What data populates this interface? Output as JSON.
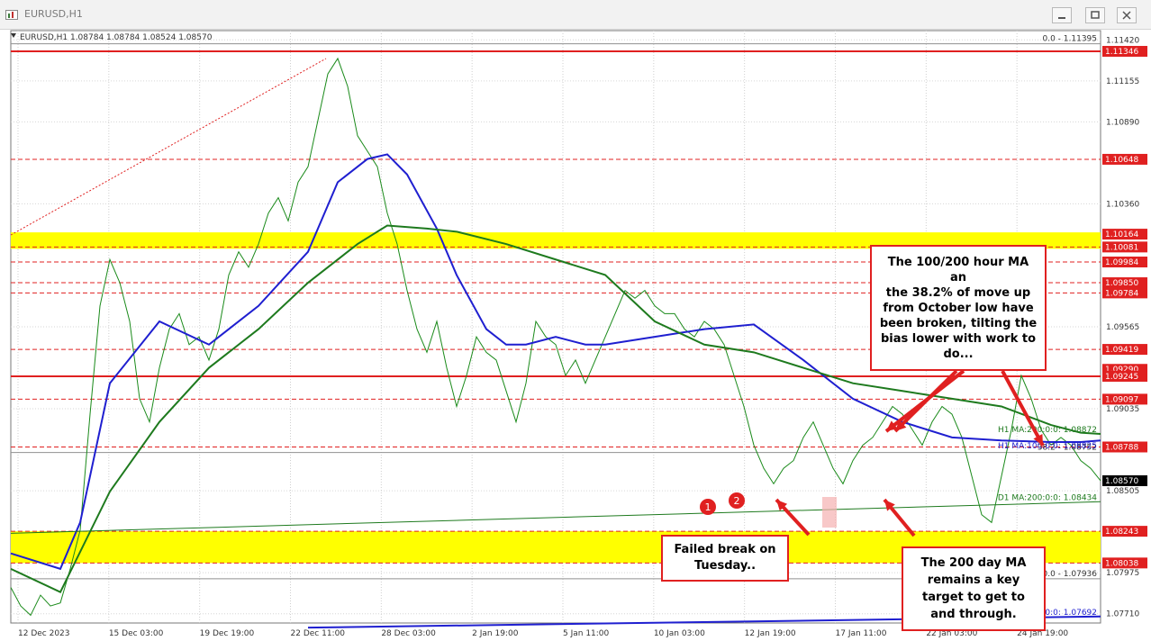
{
  "window": {
    "title": "EURUSD,H1",
    "icon": "chart-window-icon",
    "buttons": [
      "minimize-icon",
      "maximize-icon",
      "close-icon"
    ]
  },
  "header": {
    "text": "EURUSD,H1  1.08784 1.08784 1.08524 1.08570"
  },
  "colors": {
    "price": "#1a8a1a",
    "ma100": "#1f1fd0",
    "ma200": "#1e7a1e",
    "redline": "#e02020",
    "yellow": "#ffff00",
    "annot": "#e02020"
  },
  "chart_data": {
    "type": "line",
    "title": "",
    "xlabel": "",
    "ylabel": "",
    "ylim": [
      1.0765,
      1.1148
    ],
    "grid": true,
    "x_ticks": [
      "12 Dec 2023",
      "15 Dec 03:00",
      "19 Dec 19:00",
      "22 Dec 11:00",
      "28 Dec 03:00",
      "2 Jan 19:00",
      "5 Jan 11:00",
      "10 Jan 03:00",
      "12 Jan 19:00",
      "17 Jan 11:00",
      "22 Jan 03:00",
      "24 Jan 19:00"
    ],
    "y_ticks": [
      1.1142,
      1.11155,
      1.1089,
      1.1036,
      1.09565,
      1.09035,
      1.08505,
      1.07975,
      1.0771
    ],
    "price_labels": [
      {
        "label": "1.11346",
        "value": 1.11346,
        "style": "red"
      },
      {
        "label": "1.10648",
        "value": 1.10648,
        "style": "red"
      },
      {
        "label": "1.10164",
        "value": 1.10164,
        "style": "red"
      },
      {
        "label": "1.10081",
        "value": 1.10081,
        "style": "red"
      },
      {
        "label": "1.09984",
        "value": 1.09984,
        "style": "red"
      },
      {
        "label": "1.09850",
        "value": 1.0985,
        "style": "red"
      },
      {
        "label": "1.09784",
        "value": 1.09784,
        "style": "red"
      },
      {
        "label": "1.09419",
        "value": 1.09419,
        "style": "red"
      },
      {
        "label": "1.09290",
        "value": 1.0929,
        "style": "red"
      },
      {
        "label": "1.09245",
        "value": 1.09245,
        "style": "red"
      },
      {
        "label": "1.09097",
        "value": 1.09097,
        "style": "red"
      },
      {
        "label": "1.08788",
        "value": 1.08788,
        "style": "red"
      },
      {
        "label": "1.08570",
        "value": 1.0857,
        "style": "black"
      },
      {
        "label": "1.08243",
        "value": 1.08243,
        "style": "red"
      },
      {
        "label": "1.08038",
        "value": 1.08038,
        "style": "red"
      }
    ],
    "levels": [
      {
        "value": 1.11346,
        "style": "solid-red"
      },
      {
        "value": 1.10648,
        "style": "dash-red"
      },
      {
        "value": 1.10081,
        "style": "dash-red"
      },
      {
        "value": 1.09984,
        "style": "dash-red"
      },
      {
        "value": 1.0985,
        "style": "dash-red"
      },
      {
        "value": 1.09784,
        "style": "dash-red"
      },
      {
        "value": 1.09419,
        "style": "dash-red"
      },
      {
        "value": 1.09245,
        "style": "solid-red"
      },
      {
        "value": 1.09097,
        "style": "dash-red"
      },
      {
        "value": 1.08788,
        "style": "dash-red"
      },
      {
        "value": 1.08243,
        "style": "dash-red"
      },
      {
        "value": 1.08038,
        "style": "dash-red"
      },
      {
        "value": 1.07936,
        "style": "solid-grey"
      },
      {
        "value": 1.11395,
        "style": "solid-grey"
      },
      {
        "value": 1.08752,
        "style": "solid-grey"
      }
    ],
    "zones": [
      {
        "from": 1.10081,
        "to": 1.10164
      },
      {
        "from": 1.08038,
        "to": 1.08243
      }
    ],
    "fib_labels": [
      {
        "text": "0.0 - 1.11395",
        "value": 1.11395
      },
      {
        "text": "38.2 - 1.08752",
        "value": 1.08752
      },
      {
        "text": "50.0 - 1.07936",
        "value": 1.07936
      }
    ],
    "ma_labels": [
      {
        "text": "H1 MA:200:0:0: 1.08872",
        "value": 1.08872,
        "color": "green"
      },
      {
        "text": "H1 MA:100:0:0: 1.08825",
        "value": 1.08825,
        "color": "blue"
      },
      {
        "text": "D1 MA:200:0:0: 1.08434",
        "value": 1.08434,
        "color": "green"
      },
      {
        "text": ":100:0:0: 1.07692",
        "value": 1.07692,
        "color": "blue"
      }
    ],
    "series": [
      {
        "role": "price",
        "x": [
          0,
          2,
          4,
          6,
          8,
          10,
          12,
          14,
          16,
          18,
          20,
          22,
          24,
          26,
          28,
          30,
          32,
          34,
          36,
          38,
          40,
          42,
          44,
          46,
          48,
          50,
          52,
          54,
          56,
          58,
          60,
          62,
          64,
          66,
          68,
          70,
          72,
          74,
          76,
          78,
          80,
          82,
          84,
          86,
          88,
          90,
          92,
          94,
          96,
          98,
          100,
          102,
          104,
          106,
          108,
          110,
          112,
          114,
          116,
          118,
          120,
          122,
          124,
          126,
          128,
          130,
          132,
          134,
          136,
          138,
          140,
          142,
          144,
          146,
          148,
          150,
          152,
          154,
          156,
          158,
          160,
          162,
          164,
          166,
          168,
          170,
          172,
          174,
          176,
          178,
          180,
          182,
          184,
          186,
          188,
          190,
          192,
          194,
          196,
          198,
          200,
          202,
          204,
          206,
          208,
          210,
          212,
          214,
          216,
          218,
          220
        ],
        "y": [
          1.0788,
          1.0776,
          1.077,
          1.0783,
          1.0776,
          1.0778,
          1.08,
          1.0825,
          1.09,
          1.097,
          1.1,
          1.0985,
          1.096,
          1.091,
          1.0895,
          1.093,
          1.0955,
          1.0965,
          1.0945,
          1.095,
          1.0935,
          1.0955,
          1.099,
          1.1005,
          1.0995,
          1.101,
          1.103,
          1.104,
          1.1025,
          1.105,
          1.106,
          1.109,
          1.112,
          1.113,
          1.1112,
          1.108,
          1.107,
          1.106,
          1.103,
          1.101,
          1.098,
          1.0955,
          1.094,
          1.096,
          1.093,
          1.0905,
          1.0925,
          1.095,
          1.094,
          1.0935,
          1.0915,
          1.0895,
          1.092,
          1.096,
          1.095,
          1.0945,
          1.0925,
          1.0935,
          1.092,
          1.0935,
          1.095,
          1.0965,
          1.098,
          1.0975,
          1.098,
          1.097,
          1.0965,
          1.0965,
          1.0955,
          1.095,
          1.096,
          1.0955,
          1.0945,
          1.0925,
          1.0905,
          1.088,
          1.0865,
          1.0855,
          1.0865,
          1.087,
          1.0885,
          1.0895,
          1.088,
          1.0865,
          1.0855,
          1.087,
          1.088,
          1.0885,
          1.0895,
          1.0905,
          1.09,
          1.089,
          1.088,
          1.0895,
          1.0905,
          1.09,
          1.0885,
          1.086,
          1.0835,
          1.083,
          1.086,
          1.089,
          1.0925,
          1.091,
          1.089,
          1.088,
          1.0885,
          1.088,
          1.087,
          1.0865,
          1.0857
        ]
      },
      {
        "role": "ma100",
        "x": [
          0,
          10,
          14,
          20,
          30,
          40,
          50,
          60,
          66,
          72,
          76,
          80,
          86,
          90,
          96,
          100,
          104,
          110,
          116,
          120,
          130,
          140,
          150,
          160,
          170,
          180,
          190,
          200,
          210,
          216,
          220
        ],
        "y": [
          1.081,
          1.08,
          1.083,
          1.092,
          1.096,
          1.0945,
          1.097,
          1.1005,
          1.105,
          1.1065,
          1.1068,
          1.1055,
          1.102,
          1.099,
          1.0955,
          1.0945,
          1.0945,
          1.095,
          1.0945,
          1.0945,
          1.095,
          1.0955,
          1.0958,
          1.0935,
          1.091,
          1.0895,
          1.0885,
          1.0883,
          1.0882,
          1.0882,
          1.0883
        ]
      },
      {
        "role": "ma200",
        "x": [
          0,
          10,
          20,
          30,
          40,
          50,
          60,
          70,
          76,
          84,
          90,
          100,
          110,
          120,
          130,
          140,
          150,
          160,
          170,
          180,
          190,
          200,
          210,
          216,
          220
        ],
        "y": [
          1.08,
          1.0785,
          1.085,
          1.0895,
          1.093,
          1.0955,
          1.0985,
          1.101,
          1.1022,
          1.102,
          1.1018,
          1.101,
          1.1,
          1.099,
          1.096,
          1.0945,
          1.094,
          1.093,
          1.092,
          1.0915,
          1.091,
          1.0905,
          1.0893,
          1.0888,
          1.08872
        ]
      },
      {
        "role": "d1ma200",
        "x": [
          0,
          220
        ],
        "y": [
          1.0823,
          1.08434
        ]
      },
      {
        "role": "d1ma100",
        "x": [
          60,
          220
        ],
        "y": [
          1.0762,
          1.07692
        ]
      }
    ]
  },
  "annotations": {
    "ma_note": "The 100/200 hour MA an\nthe 38.2% of move up\nfrom October low have\nbeen broken, tilting the\nbias lower with work to\ndo...",
    "fail_note": "Failed break on\nTuesday..",
    "d200_note": "The 200 day MA\nremains a key\ntarget to get to\nand through.",
    "markers": [
      "1",
      "2"
    ]
  }
}
